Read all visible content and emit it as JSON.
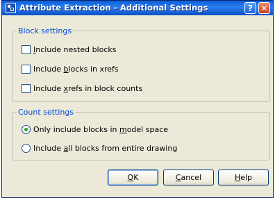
{
  "window": {
    "title": "Attribute Extraction - Additional Settings",
    "icon": "autocad-app-icon",
    "help_button": "?",
    "close_button": "✕"
  },
  "block_settings": {
    "legend": "Block settings",
    "options": [
      {
        "pre": "",
        "key": "I",
        "post": "nclude nested blocks",
        "checked": false
      },
      {
        "pre": "Include ",
        "key": "b",
        "post": "locks in xrefs",
        "checked": false
      },
      {
        "pre": "Include ",
        "key": "x",
        "post": "refs in block counts",
        "checked": false
      }
    ]
  },
  "count_settings": {
    "legend": "Count settings",
    "options": [
      {
        "pre": "Only include blocks in ",
        "key": "m",
        "post": "odel space",
        "selected": true
      },
      {
        "pre": "Include ",
        "key": "a",
        "post": "ll blocks from entire drawing",
        "selected": false
      }
    ]
  },
  "buttons": {
    "ok": {
      "key": "O",
      "post": "K"
    },
    "cancel": {
      "key": "C",
      "post": "ancel"
    },
    "help": {
      "key": "H",
      "post": "elp"
    }
  }
}
